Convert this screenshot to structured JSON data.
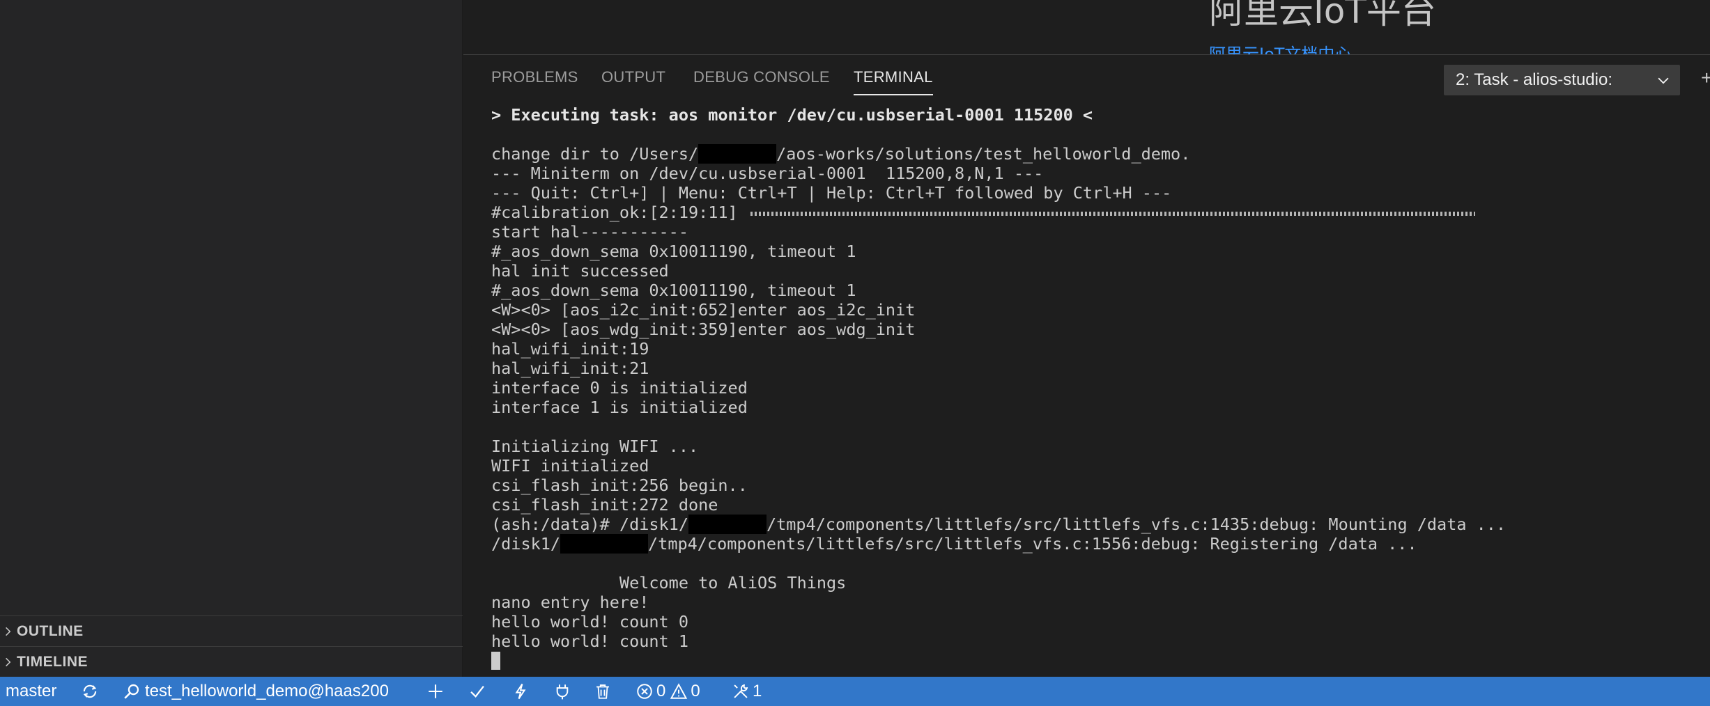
{
  "sidebar": {
    "sections": [
      {
        "label": "OUTLINE"
      },
      {
        "label": "TIMELINE"
      }
    ]
  },
  "editor": {
    "welcome_title": "阿里云IoT平台",
    "welcome_link": "阿里云IoT文档中心"
  },
  "panel": {
    "tabs": [
      {
        "label": "PROBLEMS"
      },
      {
        "label": "OUTPUT"
      },
      {
        "label": "DEBUG CONSOLE"
      },
      {
        "label": "TERMINAL",
        "active": true
      }
    ],
    "task_select": "2: Task - alios-studio:",
    "new_terminal_symbol": "+"
  },
  "terminal": {
    "lines": [
      "> Executing task: aos monitor /dev/cu.usbserial-0001 115200 <",
      "",
      "change dir to /Users/",
      "/aos-works/solutions/test_helloworld_demo.",
      "--- Miniterm on /dev/cu.usbserial-0001  115200,8,N,1 ---",
      "--- Quit: Ctrl+] | Menu: Ctrl+T | Help: Ctrl+T followed by Ctrl+H ---",
      "#calibration_ok:[2:19:11]",
      "start hal-----------",
      "#_aos_down_sema 0x10011190, timeout 1",
      "hal init successed",
      "#_aos_down_sema 0x10011190, timeout 1",
      "<W><0> [aos_i2c_init:652]enter aos_i2c_init",
      "<W><0> [aos_wdg_init:359]enter aos_wdg_init",
      "hal_wifi_init:19",
      "hal_wifi_init:21",
      "interface 0 is initialized",
      "interface 1 is initialized",
      "",
      "Initializing WIFI ...",
      "WIFI initialized",
      "csi_flash_init:256 begin..",
      "csi_flash_init:272 done",
      "(ash:/data)# /disk1/",
      "/tmp4/components/littlefs/src/littlefs_vfs.c:1435:debug: Mounting /data ...",
      "/disk1/",
      "/tmp4/components/littlefs/src/littlefs_vfs.c:1556:debug: Registering /data ...",
      "",
      "             Welcome to AliOS Things",
      "nano entry here!",
      "hello world! count 0",
      "hello world! count 1"
    ]
  },
  "statusbar": {
    "branch": "master",
    "project": "test_helloworld_demo@haas200",
    "errors": "0",
    "warnings": "0",
    "tasks": "1"
  },
  "colors": {
    "statusbar_bg": "#3277c9",
    "sidebar_bg": "#252526",
    "panel_bg": "#1e1e1e",
    "link": "#3794ff"
  }
}
